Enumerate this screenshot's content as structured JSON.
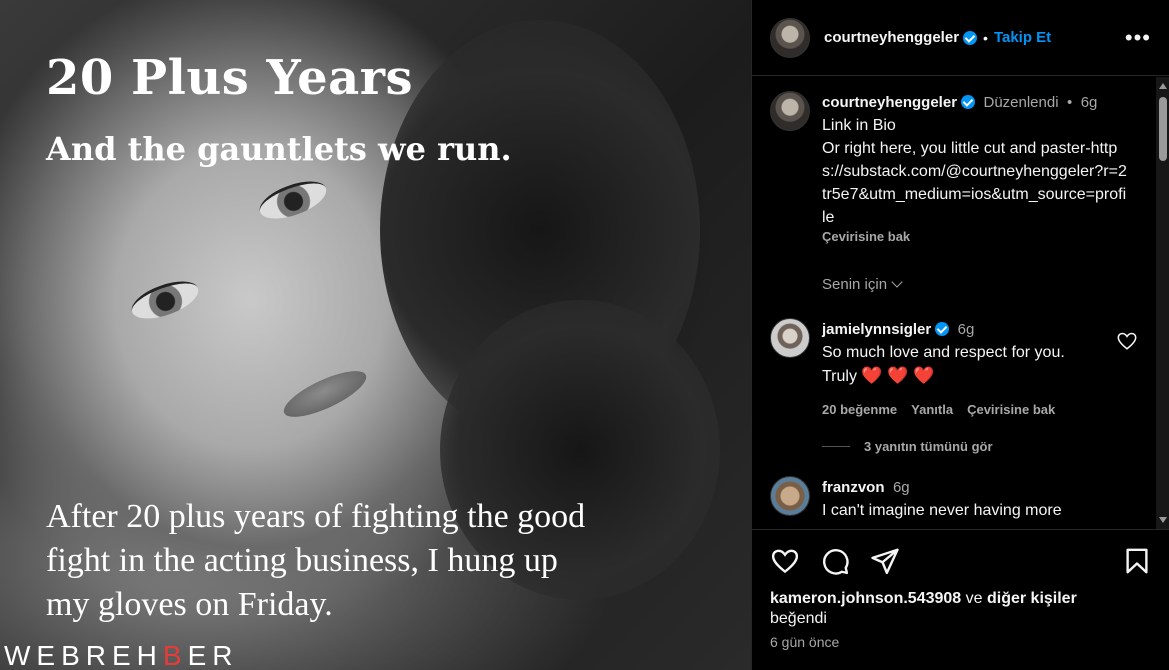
{
  "post": {
    "title": "20 Plus Years",
    "subtitle": "And the gauntlets we run.",
    "body": "After 20 plus years of fighting the good fight in the acting business, I hung up my gloves on Friday.",
    "watermark_main": "WEBREH",
    "watermark_accent": "B",
    "watermark_end": "ER"
  },
  "header": {
    "username": "courtneyhenggeler",
    "separator": "•",
    "follow_label": "Takip Et",
    "more_icon": "more-horizontal-icon"
  },
  "comments": {
    "caption": {
      "username": "courtneyhenggeler",
      "edited": "Düzenlendi",
      "separator": "•",
      "time": "6g",
      "text": "Link in Bio\nOr right here, you little cut and paster-https://substack.com/@courtneyhenggeler?r=2tr5e7&utm_medium=ios&utm_source=profile",
      "translate": "Çevirisine bak"
    },
    "for_you": "Senin için",
    "items": [
      {
        "username": "jamielynnsigler",
        "time": "6g",
        "text": "So much love and respect for you. Truly",
        "hearts": "❤️ ❤️ ❤️",
        "likes": "20 beğenme",
        "reply": "Yanıtla",
        "translate": "Çevirisine bak",
        "view_replies": "3 yanıtın tümünü gör"
      },
      {
        "username": "franzvon",
        "time": "6g",
        "text": "I can't imagine never having more"
      }
    ]
  },
  "footer": {
    "liked_by_user": "kameron.johnson.543908",
    "liked_by_mid": " ve ",
    "liked_by_others": "diğer kişiler",
    "liked_suffix": "beğendi",
    "time_ago": "6 gün önce"
  },
  "colors": {
    "accent": "#0095f6",
    "verified": "#0095f6",
    "heart": "#e0245e",
    "watermark_accent": "#e63b3b"
  }
}
